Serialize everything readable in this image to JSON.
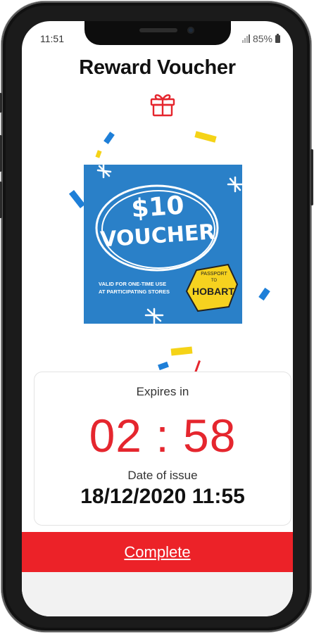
{
  "status_bar": {
    "time": "11:51",
    "battery": "85%"
  },
  "header": {
    "title": "Reward Voucher",
    "icon": "gift-icon"
  },
  "voucher": {
    "amount": "$10",
    "label": "VOUCHER",
    "terms_line1": "VALID FOR ONE-TIME USE",
    "terms_line2": "AT PARTICIPATING STORES",
    "badge_top": "PASSPORT",
    "badge_mid": "TO",
    "badge_name": "HOBART"
  },
  "timer": {
    "expires_label": "Expires in",
    "countdown": "02 : 58",
    "issue_label": "Date of issue",
    "issue_date": "18/12/2020 11:55"
  },
  "actions": {
    "complete_label": "Complete"
  },
  "colors": {
    "accent": "#ec2228",
    "countdown": "#e5262e",
    "voucher_bg": "#2a80c8",
    "badge": "#f6d21f"
  }
}
